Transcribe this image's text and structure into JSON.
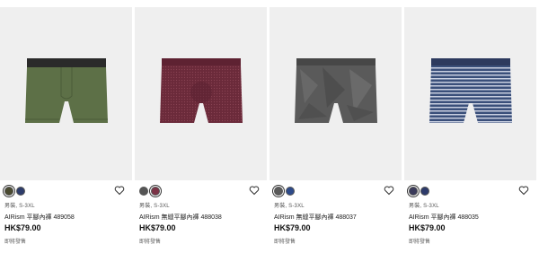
{
  "products": [
    {
      "gender_size": "男裝, S-3XL",
      "name": "AIRism 平腳內褲 489058",
      "price": "HK$79.00",
      "shipping": "即將發售",
      "swatches": [
        "#4a4a30",
        "#2d3c6b"
      ],
      "main_color": "#5d7047",
      "waistband_color": "#2a2a2a",
      "pattern": "solid"
    },
    {
      "gender_size": "男裝, S-3XL",
      "name": "AIRism 無縫平腳內褲 488038",
      "price": "HK$79.00",
      "shipping": "即將發售",
      "swatches": [
        "#555555",
        "#7c3346"
      ],
      "main_color": "#6b2a3a",
      "waistband_color": "#6b2a3a",
      "pattern": "dotted"
    },
    {
      "gender_size": "男裝, S-3XL",
      "name": "AIRism 無縫平腳內褲 488037",
      "price": "HK$79.00",
      "shipping": "即將發售",
      "swatches": [
        "#5a5a5a",
        "#2d4a8a"
      ],
      "main_color": "#5a5a5a",
      "waistband_color": "#4a4a4a",
      "pattern": "geometric"
    },
    {
      "gender_size": "男裝, S-3XL",
      "name": "AIRism 平腳內褲 488035",
      "price": "HK$79.00",
      "shipping": "即將發售",
      "swatches": [
        "#3a3a5a",
        "#2d3a6b"
      ],
      "main_color": "#3a4f7a",
      "waistband_color": "#2d3a5e",
      "pattern": "stripes"
    }
  ]
}
